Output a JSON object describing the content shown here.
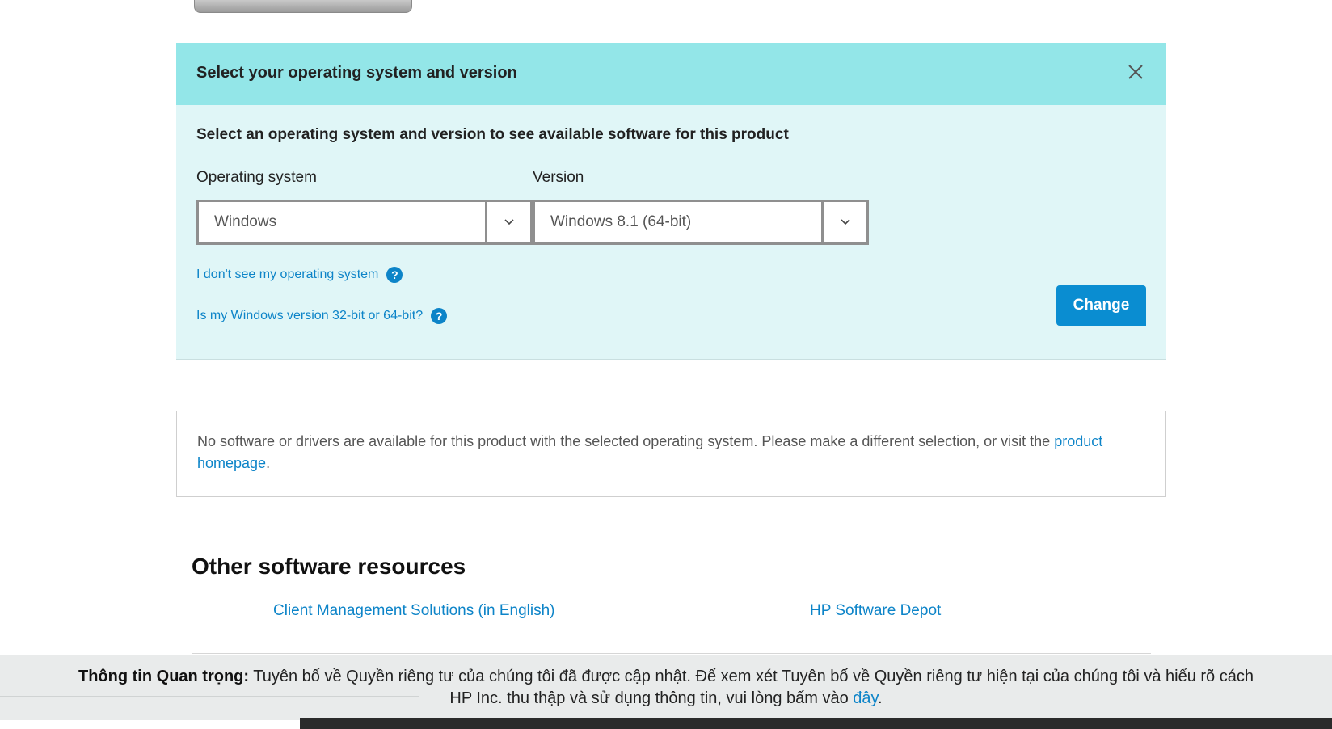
{
  "os_selector": {
    "header_title": "Select your operating system and version",
    "subtitle": "Select an operating system and version to see available software for this product",
    "os_label": "Operating system",
    "os_value": "Windows",
    "version_label": "Version",
    "version_value": "Windows 8.1 (64-bit)",
    "help_link_os": "I don't see my operating system",
    "help_link_bitness": "Is my Windows version 32-bit or 64-bit?",
    "help_icon_glyph": "?",
    "change_button": "Change"
  },
  "notice": {
    "text": "No software or drivers are available for this product with the selected operating system. Please make a different selection, or visit the",
    "link_text": "product homepage",
    "suffix": "."
  },
  "other_resources": {
    "title": "Other software resources",
    "links": [
      "Client Management Solutions (in English)",
      "HP Software Depot"
    ]
  },
  "privacy_banner": {
    "label": "Thông tin Quan trọng:",
    "text": "Tuyên bố về Quyền riêng tư của chúng tôi đã được cập nhật. Để xem xét Tuyên bố về Quyền riêng tư hiện tại của chúng tôi và hiểu rõ cách HP Inc. thu thập và sử dụng thông tin, vui lòng bấm vào",
    "link_text": "đây",
    "suffix": "."
  },
  "colors": {
    "header_teal": "#93e6e8",
    "panel_bg": "#e0f6f7",
    "link_blue": "#0d84c8",
    "button_blue": "#0a8dd1"
  },
  "icons": [
    "close-icon",
    "chevron-down-icon",
    "help-question-icon"
  ]
}
